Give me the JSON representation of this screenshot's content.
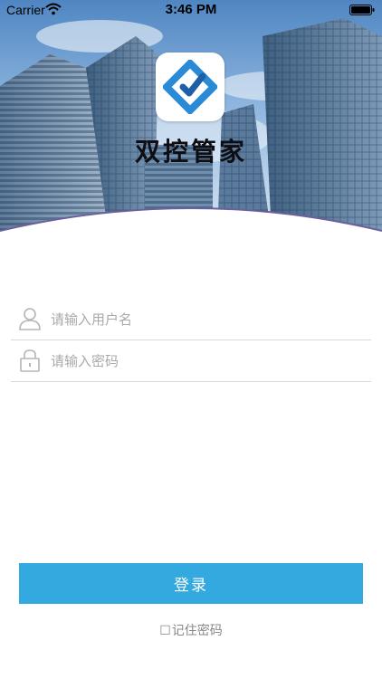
{
  "status_bar": {
    "carrier": "Carrier",
    "time": "3:46 PM"
  },
  "app": {
    "title": "双控管家",
    "logo": "diamond-check-logo",
    "brand_color": "#2a8ad6"
  },
  "form": {
    "username_placeholder": "请输入用户名",
    "password_placeholder": "请输入密码",
    "username_icon": "user-icon",
    "password_icon": "lock-icon"
  },
  "actions": {
    "login_label": "登录",
    "login_color": "#34a9e0",
    "remember_checkbox": "☐",
    "remember_label": "记住密码"
  }
}
